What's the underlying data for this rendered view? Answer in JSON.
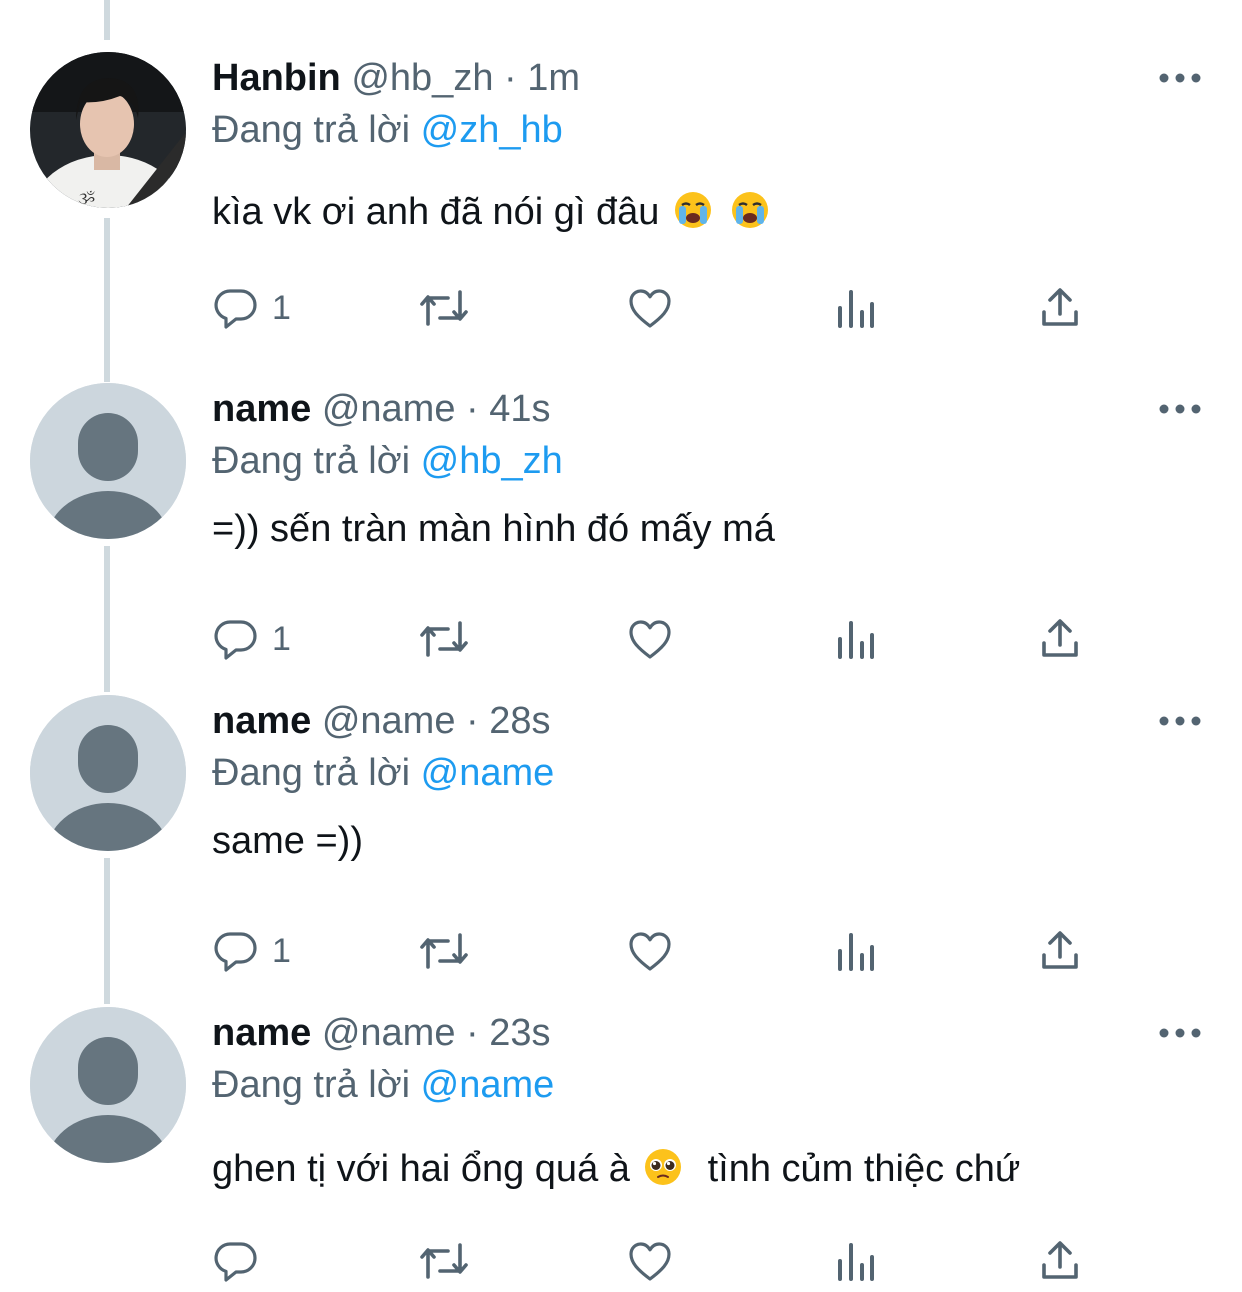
{
  "tweets": [
    {
      "display_name": "Hanbin",
      "handle": "@hb_zh",
      "separator": "·",
      "time": "1m",
      "reply_prefix": "Đang trả lời",
      "reply_to": "@zh_hb",
      "text": "kìa vk ơi anh đã nói gì đâu",
      "text_emoji": [
        "loudly-crying-face",
        "loudly-crying-face"
      ],
      "reply_count": "1",
      "avatar": "photo"
    },
    {
      "display_name": "name",
      "handle": "@name",
      "separator": "·",
      "time": "41s",
      "reply_prefix": "Đang trả lời",
      "reply_to": "@hb_zh",
      "text": "=)) sến tràn màn hình đó mấy má",
      "reply_count": "1",
      "avatar": "default-profile"
    },
    {
      "display_name": "name",
      "handle": "@name",
      "separator": "·",
      "time": "28s",
      "reply_prefix": "Đang trả lời",
      "reply_to": "@name",
      "text": "same =))",
      "reply_count": "1",
      "avatar": "default-profile"
    },
    {
      "display_name": "name",
      "handle": "@name",
      "separator": "·",
      "time": "23s",
      "reply_prefix": "Đang trả lời",
      "reply_to": "@name",
      "text_before_emoji": "ghen tị với hai ổng quá à",
      "text_emoji": [
        "pleading-face"
      ],
      "text_after_emoji": "tình củm thiệc chứ",
      "reply_count": "",
      "avatar": "default-profile"
    }
  ],
  "icons": {
    "reply": "reply-icon",
    "retweet": "retweet-icon",
    "like": "heart-icon",
    "views": "views-icon",
    "share": "share-icon",
    "more": "more-options-icon"
  },
  "colors": {
    "text": "#0f1419",
    "secondary": "#536471",
    "link": "#1d9bf0",
    "thread_line": "#cfd9de",
    "default_avatar_bg": "#ccd6dd",
    "default_avatar_fg": "#66757f"
  }
}
